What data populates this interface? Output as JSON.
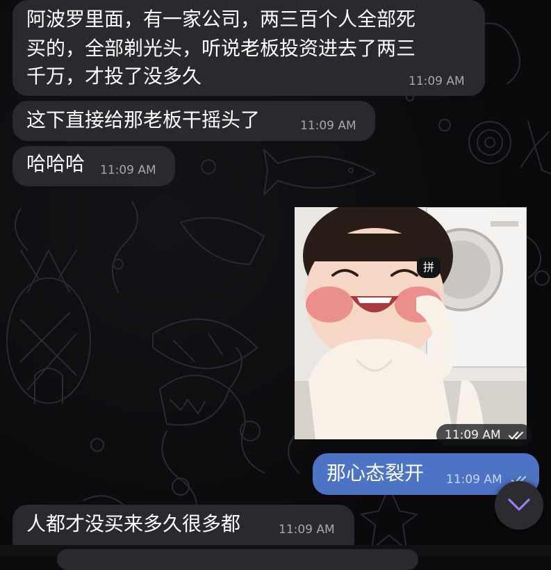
{
  "messages": [
    {
      "direction": "incoming",
      "lines": [
        "阿波罗里面，有一家公司，两三百个人全部死",
        "买的，全部剃光头，听说老板投资进去了两三",
        "千万，才投了没多久"
      ],
      "time": "11:09 AM"
    },
    {
      "direction": "incoming",
      "lines": [
        "这下直接给那老板干摇头了"
      ],
      "time": "11:09 AM"
    },
    {
      "direction": "incoming",
      "lines": [
        "哈哈哈"
      ],
      "time": "11:09 AM"
    },
    {
      "direction": "outgoing",
      "type": "sticker",
      "sticker_badge": "拼",
      "time": "11:09 AM",
      "status": "read"
    },
    {
      "direction": "outgoing",
      "lines": [
        "那心态裂开"
      ],
      "time": "11:09 AM",
      "status": "read"
    },
    {
      "direction": "incoming",
      "lines": [
        "人都才没买来多久很多都"
      ],
      "time": "11:09 AM"
    }
  ],
  "colors": {
    "incoming_bubble": "#2a2a2e",
    "outgoing_bubble": "#4c73c4",
    "background": "#0b0b0d"
  },
  "icons": {
    "scroll_down": "chevron-down-icon",
    "read_status": "double-check-icon"
  }
}
